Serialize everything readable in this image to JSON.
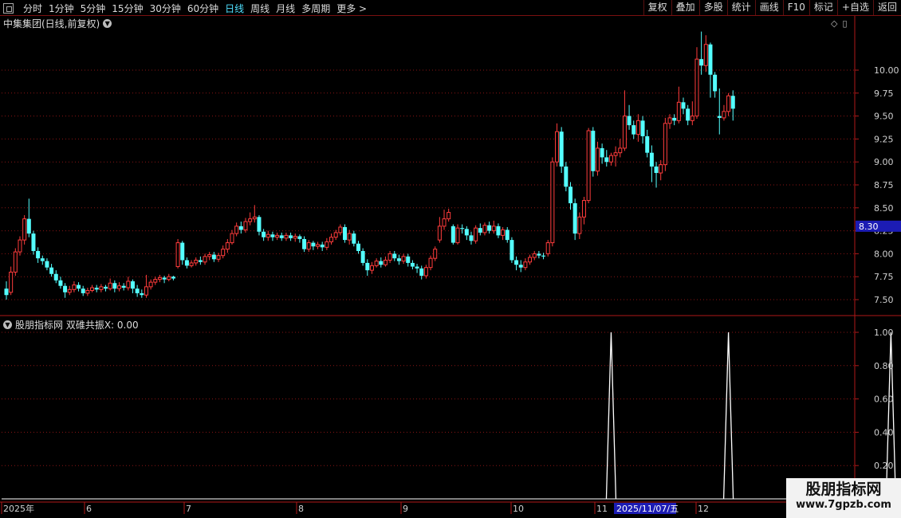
{
  "toolbar": {
    "periods": [
      "分时",
      "1分钟",
      "5分钟",
      "15分钟",
      "30分钟",
      "60分钟",
      "日线",
      "周线",
      "月线",
      "多周期",
      "更多 >"
    ],
    "active_period": "日线",
    "buttons": [
      "复权",
      "叠加",
      "多股",
      "统计",
      "画线",
      "F10",
      "标记",
      "+自选",
      "返回"
    ]
  },
  "main_panel": {
    "title": "中集集团(日线,前复权)",
    "price_ticks": [
      "10.00",
      "9.75",
      "9.50",
      "9.25",
      "9.00",
      "8.75",
      "8.50",
      "8.25",
      "8.00",
      "7.75",
      "7.50"
    ],
    "current_price": "8.30"
  },
  "sub_panel": {
    "title": "股朋指标网 双碓共振X: 0.00",
    "ticks": [
      "1.00",
      "0.80",
      "0.60",
      "0.40",
      "0.20"
    ]
  },
  "date_axis": {
    "labels": [
      "2025年",
      "6",
      "7",
      "8",
      "9",
      "10",
      "11",
      "12"
    ],
    "highlight": "2025/11/07/五"
  },
  "watermark": {
    "line1": "股朋指标网",
    "line2": "www.7gpzb.com"
  },
  "colors": {
    "up": "#ff3c3c",
    "down": "#54ffff",
    "grid": "#8a1515",
    "axis": "#b01818",
    "signal": "#ffffff",
    "highlight_bg": "#1c1cb4"
  },
  "chart_data": [
    {
      "type": "candlestick",
      "title": "中集集团(日线,前复权)",
      "ylim": [
        7.4,
        10.3
      ],
      "x_month_labels": [
        "2025年",
        "6",
        "7",
        "8",
        "9",
        "10",
        "11",
        "12"
      ],
      "candles": [
        [
          7.62,
          7.55,
          7.7,
          7.5
        ],
        [
          7.58,
          7.8,
          7.86,
          7.55
        ],
        [
          7.8,
          8.02,
          8.06,
          7.76
        ],
        [
          8.02,
          8.15,
          8.19,
          7.98
        ],
        [
          8.15,
          8.38,
          8.42,
          8.1
        ],
        [
          8.38,
          8.22,
          8.6,
          8.18
        ],
        [
          8.22,
          8.03,
          8.25,
          7.99
        ],
        [
          8.03,
          7.95,
          8.07,
          7.9
        ],
        [
          7.95,
          7.92,
          7.98,
          7.88
        ],
        [
          7.92,
          7.85,
          7.95,
          7.82
        ],
        [
          7.85,
          7.78,
          7.89,
          7.75
        ],
        [
          7.78,
          7.71,
          7.82,
          7.68
        ],
        [
          7.71,
          7.65,
          7.75,
          7.62
        ],
        [
          7.65,
          7.58,
          7.68,
          7.52
        ],
        [
          7.58,
          7.61,
          7.65,
          7.55
        ],
        [
          7.61,
          7.66,
          7.7,
          7.58
        ],
        [
          7.66,
          7.62,
          7.69,
          7.59
        ],
        [
          7.62,
          7.57,
          7.65,
          7.54
        ],
        [
          7.57,
          7.6,
          7.63,
          7.54
        ],
        [
          7.6,
          7.63,
          7.66,
          7.58
        ],
        [
          7.63,
          7.61,
          7.66,
          7.58
        ],
        [
          7.61,
          7.64,
          7.67,
          7.58
        ],
        [
          7.64,
          7.62,
          7.66,
          7.59
        ],
        [
          7.62,
          7.68,
          7.73,
          7.6
        ],
        [
          7.68,
          7.62,
          7.71,
          7.58
        ],
        [
          7.62,
          7.65,
          7.69,
          7.59
        ],
        [
          7.65,
          7.63,
          7.68,
          7.6
        ],
        [
          7.63,
          7.7,
          7.75,
          7.6
        ],
        [
          7.7,
          7.62,
          7.72,
          7.57
        ],
        [
          7.62,
          7.57,
          7.66,
          7.53
        ],
        [
          7.57,
          7.55,
          7.61,
          7.52
        ],
        [
          7.55,
          7.64,
          7.77,
          7.52
        ],
        [
          7.64,
          7.69,
          7.72,
          7.61
        ],
        [
          7.69,
          7.72,
          7.75,
          7.66
        ],
        [
          7.72,
          7.74,
          7.77,
          7.69
        ],
        [
          7.74,
          7.72,
          7.76,
          7.68
        ],
        [
          7.72,
          7.75,
          7.78,
          7.7
        ],
        [
          7.75,
          7.73,
          7.76,
          7.71
        ],
        [
          7.86,
          8.12,
          8.16,
          7.84
        ],
        [
          8.12,
          7.93,
          8.14,
          7.88
        ],
        [
          7.93,
          7.87,
          7.96,
          7.84
        ],
        [
          7.87,
          7.9,
          7.93,
          7.85
        ],
        [
          7.9,
          7.93,
          7.96,
          7.87
        ],
        [
          7.93,
          7.91,
          7.97,
          7.88
        ],
        [
          7.91,
          7.97,
          8.0,
          7.88
        ],
        [
          7.97,
          7.99,
          8.02,
          7.93
        ],
        [
          7.99,
          7.94,
          8.02,
          7.91
        ],
        [
          7.94,
          7.98,
          8.01,
          7.91
        ],
        [
          7.98,
          8.05,
          8.09,
          7.95
        ],
        [
          8.05,
          8.12,
          8.16,
          8.01
        ],
        [
          8.12,
          8.22,
          8.26,
          8.1
        ],
        [
          8.22,
          8.3,
          8.34,
          8.19
        ],
        [
          8.3,
          8.26,
          8.35,
          8.22
        ],
        [
          8.26,
          8.35,
          8.39,
          8.23
        ],
        [
          8.35,
          8.38,
          8.45,
          8.31
        ],
        [
          8.38,
          8.4,
          8.53,
          8.34
        ],
        [
          8.4,
          8.24,
          8.42,
          8.2
        ],
        [
          8.24,
          8.18,
          8.27,
          8.14
        ],
        [
          8.18,
          8.21,
          8.25,
          8.14
        ],
        [
          8.21,
          8.18,
          8.24,
          8.14
        ],
        [
          8.18,
          8.2,
          8.23,
          8.15
        ],
        [
          8.2,
          8.17,
          8.23,
          8.14
        ],
        [
          8.17,
          8.2,
          8.23,
          8.14
        ],
        [
          8.2,
          8.17,
          8.23,
          8.14
        ],
        [
          8.17,
          8.19,
          8.22,
          8.13
        ],
        [
          8.19,
          8.16,
          8.21,
          8.12
        ],
        [
          8.16,
          8.05,
          8.19,
          8.02
        ],
        [
          8.05,
          8.12,
          8.15,
          8.02
        ],
        [
          8.12,
          8.08,
          8.14,
          8.04
        ],
        [
          8.08,
          8.1,
          8.13,
          8.05
        ],
        [
          8.1,
          8.07,
          8.13,
          8.03
        ],
        [
          8.07,
          8.13,
          8.17,
          8.04
        ],
        [
          8.13,
          8.18,
          8.22,
          8.1
        ],
        [
          8.18,
          8.23,
          8.26,
          8.15
        ],
        [
          8.23,
          8.29,
          8.32,
          8.2
        ],
        [
          8.29,
          8.15,
          8.32,
          8.12
        ],
        [
          8.15,
          8.22,
          8.26,
          8.1
        ],
        [
          8.22,
          8.11,
          8.25,
          8.08
        ],
        [
          8.11,
          8.03,
          8.14,
          8.0
        ],
        [
          8.03,
          7.9,
          8.06,
          7.87
        ],
        [
          7.9,
          7.82,
          7.94,
          7.76
        ],
        [
          7.82,
          7.87,
          7.91,
          7.78
        ],
        [
          7.87,
          7.92,
          7.95,
          7.85
        ],
        [
          7.92,
          7.88,
          7.96,
          7.85
        ],
        [
          7.88,
          7.93,
          7.97,
          7.86
        ],
        [
          7.93,
          8.0,
          8.03,
          7.9
        ],
        [
          8.0,
          7.95,
          8.03,
          7.92
        ],
        [
          7.95,
          7.92,
          7.99,
          7.88
        ],
        [
          7.92,
          7.97,
          8.0,
          7.89
        ],
        [
          7.97,
          7.9,
          8.0,
          7.86
        ],
        [
          7.9,
          7.86,
          7.93,
          7.83
        ],
        [
          7.86,
          7.84,
          7.89,
          7.79
        ],
        [
          7.84,
          7.76,
          7.87,
          7.72
        ],
        [
          7.76,
          7.85,
          7.88,
          7.73
        ],
        [
          7.85,
          7.95,
          7.98,
          7.82
        ],
        [
          7.95,
          8.05,
          8.08,
          7.92
        ],
        [
          8.15,
          8.3,
          8.4,
          8.12
        ],
        [
          8.3,
          8.38,
          8.48,
          8.26
        ],
        [
          8.38,
          8.45,
          8.49,
          8.35
        ],
        [
          8.3,
          8.12,
          8.32,
          8.1
        ],
        [
          8.12,
          8.28,
          8.32,
          8.1
        ],
        [
          8.28,
          8.27,
          8.32,
          8.22
        ],
        [
          8.27,
          8.2,
          8.3,
          8.15
        ],
        [
          8.2,
          8.14,
          8.24,
          8.1
        ],
        [
          8.14,
          8.28,
          8.31,
          8.11
        ],
        [
          8.28,
          8.23,
          8.33,
          8.2
        ],
        [
          8.23,
          8.31,
          8.34,
          8.2
        ],
        [
          8.31,
          8.25,
          8.35,
          8.22
        ],
        [
          8.25,
          8.3,
          8.36,
          8.22
        ],
        [
          8.3,
          8.2,
          8.33,
          8.17
        ],
        [
          8.2,
          8.26,
          8.29,
          8.15
        ],
        [
          8.26,
          8.15,
          8.29,
          8.12
        ],
        [
          8.15,
          7.93,
          8.18,
          7.9
        ],
        [
          7.93,
          7.88,
          7.97,
          7.82
        ],
        [
          7.88,
          7.85,
          7.93,
          7.8
        ],
        [
          7.85,
          7.91,
          7.95,
          7.82
        ],
        [
          7.91,
          7.96,
          7.99,
          7.88
        ],
        [
          7.96,
          8.0,
          8.03,
          7.93
        ],
        [
          8.0,
          7.98,
          8.03,
          7.95
        ],
        [
          7.98,
          7.97,
          8.01,
          7.94
        ],
        [
          8.0,
          8.12,
          8.15,
          7.97
        ],
        [
          8.12,
          9.0,
          9.05,
          8.08
        ],
        [
          9.0,
          9.33,
          9.42,
          8.95
        ],
        [
          9.33,
          8.95,
          9.38,
          8.88
        ],
        [
          8.95,
          8.73,
          9.0,
          8.68
        ],
        [
          8.73,
          8.55,
          8.78,
          8.48
        ],
        [
          8.55,
          8.22,
          8.6,
          8.15
        ],
        [
          8.22,
          8.4,
          8.45,
          8.16
        ],
        [
          8.4,
          8.58,
          8.62,
          8.32
        ],
        [
          8.58,
          9.34,
          9.37,
          8.55
        ],
        [
          9.34,
          8.9,
          9.38,
          8.84
        ],
        [
          8.9,
          9.15,
          9.22,
          8.85
        ],
        [
          9.15,
          9.05,
          9.2,
          8.98
        ],
        [
          9.05,
          9.0,
          9.13,
          8.95
        ],
        [
          9.0,
          9.07,
          9.1,
          8.96
        ],
        [
          9.07,
          9.1,
          9.17,
          8.95
        ],
        [
          9.1,
          9.15,
          9.25,
          9.05
        ],
        [
          9.15,
          9.5,
          9.78,
          9.12
        ],
        [
          9.5,
          9.4,
          9.62,
          9.35
        ],
        [
          9.4,
          9.3,
          9.45,
          9.25
        ],
        [
          9.3,
          9.45,
          9.52,
          9.22
        ],
        [
          9.45,
          9.28,
          9.5,
          9.2
        ],
        [
          9.28,
          9.1,
          9.35,
          9.05
        ],
        [
          9.1,
          8.95,
          9.18,
          8.78
        ],
        [
          8.95,
          8.88,
          9.0,
          8.72
        ],
        [
          8.88,
          8.97,
          9.02,
          8.8
        ],
        [
          8.97,
          9.42,
          9.48,
          8.9
        ],
        [
          9.42,
          9.48,
          9.52,
          9.36
        ],
        [
          9.48,
          9.45,
          9.52,
          9.4
        ],
        [
          9.45,
          9.65,
          9.82,
          9.42
        ],
        [
          9.65,
          9.58,
          9.7,
          9.52
        ],
        [
          9.58,
          9.45,
          9.62,
          9.4
        ],
        [
          9.45,
          9.5,
          9.66,
          9.4
        ],
        [
          9.5,
          10.12,
          10.25,
          9.47
        ],
        [
          10.12,
          10.05,
          10.42,
          9.95
        ],
        [
          10.05,
          10.28,
          10.38,
          9.98
        ],
        [
          10.28,
          9.95,
          10.3,
          9.7
        ],
        [
          9.95,
          9.77,
          9.98,
          9.7
        ],
        [
          9.5,
          9.48,
          9.8,
          9.3
        ],
        [
          9.48,
          9.55,
          9.62,
          9.45
        ],
        [
          9.55,
          9.72,
          9.75,
          9.5
        ],
        [
          9.72,
          9.58,
          9.78,
          9.45
        ]
      ]
    },
    {
      "type": "line",
      "title": "股朋指标网 双碓共振X: 0.00",
      "ylim": [
        0,
        1.05
      ],
      "signal_candle_indices": [
        134,
        160,
        196
      ],
      "value": 1.0
    }
  ]
}
